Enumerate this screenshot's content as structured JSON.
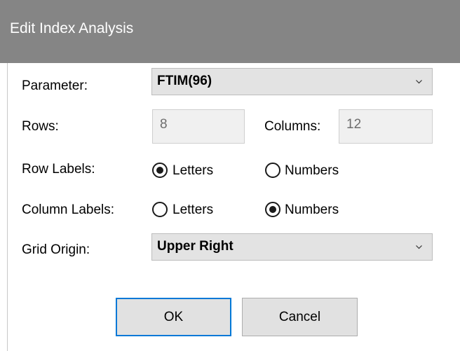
{
  "window": {
    "title": "Edit Index Analysis"
  },
  "parameter": {
    "label": "Parameter:",
    "value": "FTIM(96)",
    "icon": "chevron-down-icon"
  },
  "rows": {
    "label": "Rows:",
    "value": "8"
  },
  "columns": {
    "label": "Columns:",
    "value": "12"
  },
  "row_labels": {
    "label": "Row Labels:",
    "options": [
      "Letters",
      "Numbers"
    ],
    "selected": "Letters"
  },
  "column_labels": {
    "label": "Column Labels:",
    "options": [
      "Letters",
      "Numbers"
    ],
    "selected": "Numbers"
  },
  "grid_origin": {
    "label": "Grid Origin:",
    "value": "Upper Right",
    "icon": "chevron-down-icon"
  },
  "buttons": {
    "ok": "OK",
    "cancel": "Cancel"
  },
  "colors": {
    "titlebar": "#858585",
    "default_button_border": "#0078d7"
  }
}
